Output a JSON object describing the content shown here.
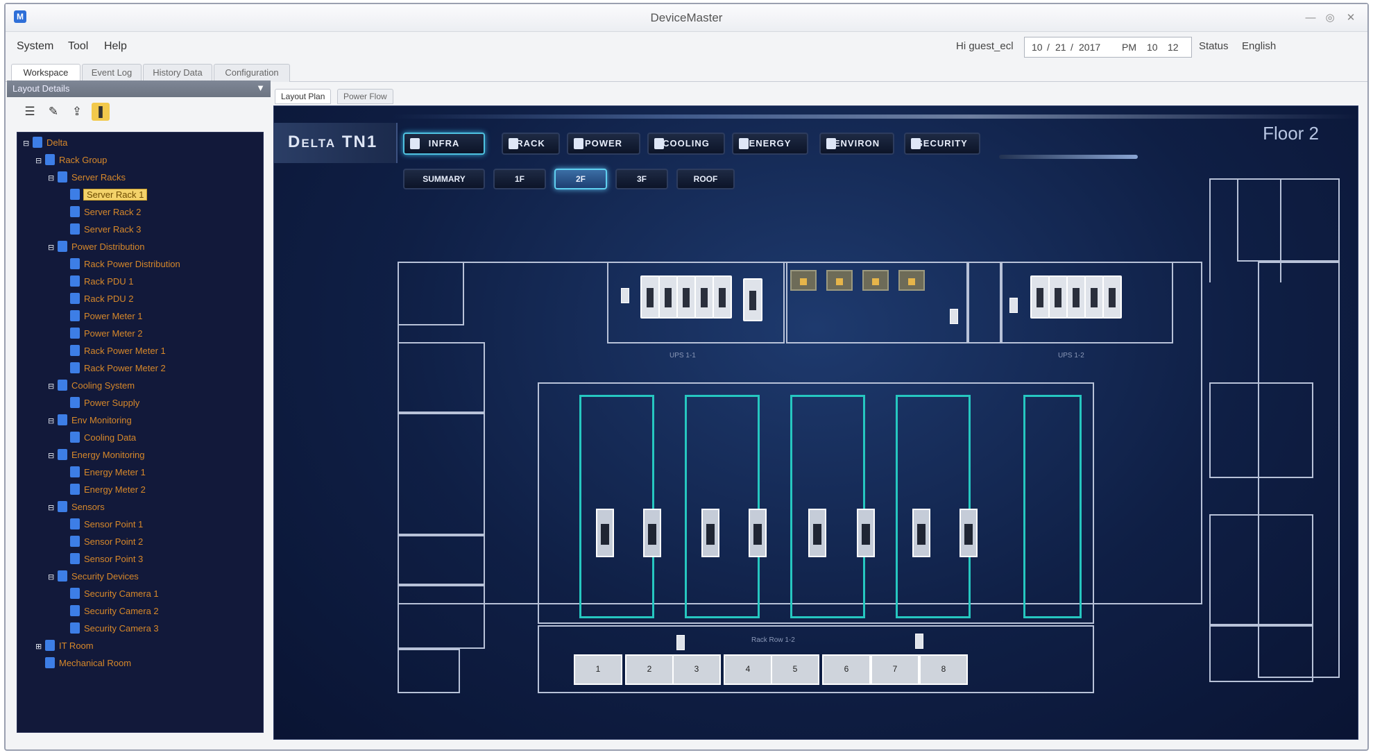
{
  "window": {
    "title": "DeviceMaster"
  },
  "menu": {
    "items": [
      "System",
      "Tool",
      "Help"
    ]
  },
  "header": {
    "user": "Hi guest_ecl",
    "date_month": "10",
    "date_day": "21",
    "date_year": "2017",
    "ampm": "PM",
    "hour": "10",
    "minute": "12",
    "status_label": "Status",
    "language": "English"
  },
  "main_tabs": [
    "Workspace",
    "Event Log",
    "History Data",
    "Configuration"
  ],
  "left_panel": {
    "title": "Layout Details",
    "tree": [
      {
        "label": "Delta",
        "level": 0,
        "toggle": "⊟"
      },
      {
        "label": "Rack Group",
        "level": 1,
        "toggle": "⊟"
      },
      {
        "label": "Server Racks",
        "level": 2,
        "toggle": "⊟"
      },
      {
        "label": "Server Rack 1",
        "level": 3,
        "toggle": "",
        "selected": true
      },
      {
        "label": "Server Rack 2",
        "level": 3,
        "toggle": ""
      },
      {
        "label": "Server Rack 3",
        "level": 3,
        "toggle": ""
      },
      {
        "label": "Power Distribution",
        "level": 2,
        "toggle": "⊟"
      },
      {
        "label": "Rack Power Distribution",
        "level": 3,
        "toggle": ""
      },
      {
        "label": "Rack PDU 1",
        "level": 3,
        "toggle": ""
      },
      {
        "label": "Rack PDU 2",
        "level": 3,
        "toggle": ""
      },
      {
        "label": "Power Meter 1",
        "level": 3,
        "toggle": ""
      },
      {
        "label": "Power Meter 2",
        "level": 3,
        "toggle": ""
      },
      {
        "label": "Rack Power Meter 1",
        "level": 3,
        "toggle": ""
      },
      {
        "label": "Rack Power Meter 2",
        "level": 3,
        "toggle": ""
      },
      {
        "label": "Cooling System",
        "level": 2,
        "toggle": "⊟"
      },
      {
        "label": "Power Supply",
        "level": 3,
        "toggle": ""
      },
      {
        "label": "Env Monitoring",
        "level": 2,
        "toggle": "⊟"
      },
      {
        "label": "Cooling Data",
        "level": 3,
        "toggle": ""
      },
      {
        "label": "Energy Monitoring",
        "level": 2,
        "toggle": "⊟"
      },
      {
        "label": "Energy Meter 1",
        "level": 3,
        "toggle": ""
      },
      {
        "label": "Energy Meter 2",
        "level": 3,
        "toggle": ""
      },
      {
        "label": "Sensors",
        "level": 2,
        "toggle": "⊟"
      },
      {
        "label": "Sensor Point 1",
        "level": 3,
        "toggle": ""
      },
      {
        "label": "Sensor Point 2",
        "level": 3,
        "toggle": ""
      },
      {
        "label": "Sensor Point 3",
        "level": 3,
        "toggle": ""
      },
      {
        "label": "Security Devices",
        "level": 2,
        "toggle": "⊟"
      },
      {
        "label": "Security Camera 1",
        "level": 3,
        "toggle": ""
      },
      {
        "label": "Security Camera 2",
        "level": 3,
        "toggle": ""
      },
      {
        "label": "Security Camera 3",
        "level": 3,
        "toggle": ""
      },
      {
        "label": "IT Room",
        "level": 1,
        "toggle": "⊞"
      },
      {
        "label": "Mechanical Room",
        "level": 1,
        "toggle": ""
      }
    ]
  },
  "view_tabs": [
    "Layout Plan",
    "Power Flow"
  ],
  "dashboard": {
    "site_title": "Delta TN1",
    "floor": "Floor 2",
    "nav": [
      "Infra",
      "Rack",
      "Power",
      "Cooling",
      "Energy",
      "Environ",
      "Security"
    ],
    "active_nav": "Infra",
    "floors": [
      "Summary",
      "1F",
      "2F",
      "3F",
      "Roof"
    ],
    "active_floor": "2F",
    "plan_labels": {
      "ups_left": "UPS 1-1",
      "ups_right": "UPS 1-2",
      "rack_row": "Rack Row 1-2"
    },
    "pdus": [
      "1",
      "2",
      "3",
      "4",
      "5",
      "6",
      "7",
      "8"
    ]
  }
}
